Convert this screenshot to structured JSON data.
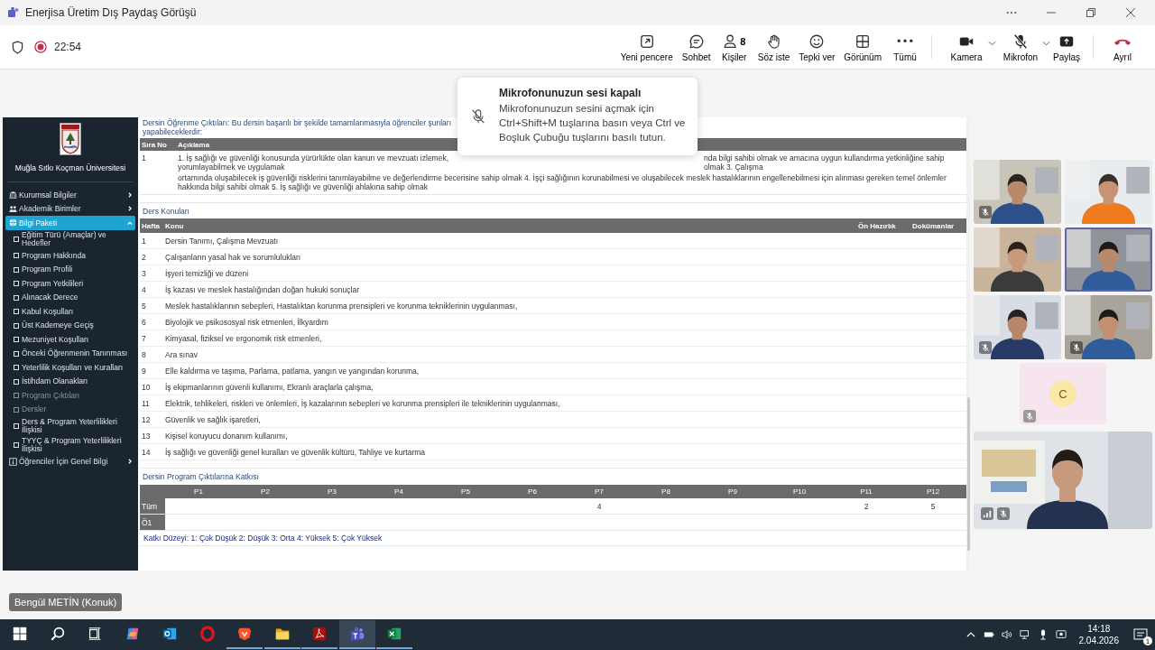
{
  "window": {
    "title": "Enerjisa Üretim Dış Paydaş Görüşü"
  },
  "meeting": {
    "recording": true,
    "elapsed": "22:54"
  },
  "controls": [
    {
      "kind": "popout",
      "label": "Yeni pencere"
    },
    {
      "kind": "chat",
      "label": "Sohbet"
    },
    {
      "kind": "people",
      "label": "Kişiler",
      "count": "8"
    },
    {
      "kind": "hand",
      "label": "Söz iste"
    },
    {
      "kind": "react",
      "label": "Tepki ver"
    },
    {
      "kind": "view",
      "label": "Görünüm"
    },
    {
      "kind": "more",
      "label": "Tümü"
    },
    {
      "kind": "camera",
      "label": "Kamera",
      "on": true
    },
    {
      "kind": "mic",
      "label": "Mikrofon",
      "on": false
    },
    {
      "kind": "share",
      "label": "Paylaş"
    },
    {
      "kind": "leave",
      "label": "Ayrıl"
    }
  ],
  "toast": {
    "title": "Mikrofonunuzun sesi kapalı",
    "message": "Mikrofonunuzun sesini açmak için Ctrl+Shift+M tuşlarına basın veya Ctrl ve Boşluk Çubuğu tuşlarını basılı tutun."
  },
  "shared_screen": {
    "sidebar": {
      "university": "Muğla Sıtkı Koçman Üniversitesi",
      "items": [
        {
          "kind": "building",
          "label": "Kurumsal Bilgiler",
          "expanded": false,
          "selected": false
        },
        {
          "kind": "people",
          "label": "Akademik Birimler",
          "expanded": false,
          "selected": false
        },
        {
          "kind": "globe",
          "label": "Bilgi Paketi",
          "expanded": true,
          "selected": true,
          "children": [
            {
              "label": "Eğitim Türü (Amaçlar) ve Hedefler",
              "disabled": false
            },
            {
              "label": "Program Hakkında",
              "disabled": false
            },
            {
              "label": "Program Profili",
              "disabled": false
            },
            {
              "label": "Program Yetkilileri",
              "disabled": false
            },
            {
              "label": "Alınacak Derece",
              "disabled": false
            },
            {
              "label": "Kabul Koşulları",
              "disabled": false
            },
            {
              "label": "Üst Kademeye Geçiş",
              "disabled": false
            },
            {
              "label": "Mezuniyet Koşulları",
              "disabled": false
            },
            {
              "label": "Önceki Öğrenmenin Tanınması",
              "disabled": false
            },
            {
              "label": "Yeterlilik Koşulları ve Kuralları",
              "disabled": false
            },
            {
              "label": "İstihdam Olanakları",
              "disabled": false
            },
            {
              "label": "Program Çıktıları",
              "disabled": true
            },
            {
              "label": "Dersler",
              "disabled": true
            },
            {
              "label": "Ders & Program Yeterlilikleri İlişkisi",
              "disabled": false
            },
            {
              "label": "TYYÇ & Program Yeterlilikleri İlişkisi",
              "disabled": false
            }
          ]
        },
        {
          "kind": "info",
          "label": "Öğrenciler İçin Genel Bilgi",
          "expanded": false,
          "selected": false
        }
      ]
    },
    "outcomes": {
      "heading": "Dersin Öğrenme Çıktıları: Bu dersin başarılı bir şekilde tamamlanmasıyla öğrenciler şunları yapabileceklerdir:",
      "columns": [
        "Sıra No",
        "Açıklama"
      ],
      "rows": [
        {
          "no": "1",
          "line_1_left": "1. İş sağlığı ve güvenliği konusunda yürürlükte olan kanun ve mevzuatı izlemek, yorumlayabilmek ve uygulamak",
          "line_1_right": "nda bilgi sahibi olmak ve amacına uygun kullandırma yetkinliğine sahip olmak 3. Çalışma",
          "line_2": "ortamında oluşabilecek iş güvenliği risklerini tanımlayabilme ve değerlendirme becerisine sahip olmak 4. İşçi sağlığının korunabilmesi ve oluşabilecek meslek hastalıklarının engellenebilmesi için alınması gereken temel önlemler hakkında bilgi sahibi olmak 5. İş sağlığı ve güvenliği ahlakına sahip olmak"
        }
      ]
    },
    "topics": {
      "heading": "Ders Konuları",
      "columns": [
        "Hafta",
        "Konu",
        "Ön Hazırlık",
        "Dokümanlar"
      ],
      "rows": [
        {
          "week": "1",
          "topic": "Dersin Tanımı, Çalışma Mevzuatı"
        },
        {
          "week": "2",
          "topic": "Çalışanların yasal hak ve sorumlulukları"
        },
        {
          "week": "3",
          "topic": "İşyeri temizliği ve düzeni"
        },
        {
          "week": "4",
          "topic": "İş kazası ve meslek hastalığından doğan hukuki sonuçlar"
        },
        {
          "week": "5",
          "topic": "Meslek hastalıklarının sebepleri, Hastalıktan korunma prensipleri ve korunma tekniklerinin uygulanması,"
        },
        {
          "week": "6",
          "topic": "Biyolojik ve psikososyal risk etmenleri, İlkyardım"
        },
        {
          "week": "7",
          "topic": "Kimyasal, fiziksel ve ergonomik risk etmenleri,"
        },
        {
          "week": "8",
          "topic": "Ara sınav"
        },
        {
          "week": "9",
          "topic": "Elle kaldırma ve taşıma, Parlama, patlama, yangın ve yangından korunma,"
        },
        {
          "week": "10",
          "topic": "İş ekipmanlarının güvenli kullanımı, Ekranlı araçlarla çalışma,"
        },
        {
          "week": "11",
          "topic": "Elektrik, tehlikeleri, riskleri ve önlemleri, İş kazalarının sebepleri ve korunma prensipleri ile tekniklerinin uygulanması,"
        },
        {
          "week": "12",
          "topic": "Güvenlik ve sağlık işaretleri,"
        },
        {
          "week": "13",
          "topic": "Kişisel koruyucu donanım kullanımı,"
        },
        {
          "week": "14",
          "topic": "İş sağlığı ve güvenliği genel kuralları ve güvenlik kültürü, Tahliye ve kurtarma"
        }
      ]
    },
    "contribution": {
      "heading": "Dersin Program Çıktılarına Katkısı",
      "row_labels": [
        "Tüm",
        "Ö1"
      ],
      "columns": [
        {
          "label": "P1"
        },
        {
          "label": "P2"
        },
        {
          "label": "P3"
        },
        {
          "label": "P4"
        },
        {
          "label": "P5"
        },
        {
          "label": "P6"
        },
        {
          "label": "P7",
          "row_1": "4"
        },
        {
          "label": "P8"
        },
        {
          "label": "P9"
        },
        {
          "label": "P10"
        },
        {
          "label": "P11",
          "row_1": "2"
        },
        {
          "label": "P12",
          "row_1": "5"
        }
      ],
      "legend": "Katkı Düzeyi: 1: Çok Düşük 2: Düşük 3: Orta 4: Yüksek 5: Çok Yüksek"
    }
  },
  "participants": [
    {
      "kind": "video",
      "muted": true,
      "speaking": false
    },
    {
      "kind": "video",
      "muted": false,
      "speaking": false
    },
    {
      "kind": "video",
      "muted": false,
      "speaking": false
    },
    {
      "kind": "video",
      "muted": false,
      "speaking": true
    },
    {
      "kind": "video",
      "muted": true,
      "speaking": false
    },
    {
      "kind": "video",
      "muted": true,
      "speaking": false
    },
    {
      "kind": "avatar",
      "initial": "C",
      "muted": true,
      "speaking": false
    },
    {
      "kind": "featured",
      "muted": true,
      "speaking": false
    }
  ],
  "name_tag": "Bengül METİN (Konuk)",
  "taskbar": {
    "apps": [
      {
        "kind": "search",
        "running": false,
        "selected": false
      },
      {
        "kind": "taskview",
        "running": false,
        "selected": false
      },
      {
        "kind": "copilot",
        "running": false,
        "selected": false
      },
      {
        "kind": "mail",
        "running": false,
        "selected": false
      },
      {
        "kind": "ring",
        "running": false,
        "selected": false
      },
      {
        "kind": "lion",
        "running": true,
        "selected": false
      },
      {
        "kind": "folder",
        "running": true,
        "selected": false
      },
      {
        "kind": "pdf",
        "running": true,
        "selected": false
      },
      {
        "kind": "teams",
        "running": true,
        "selected": true
      },
      {
        "kind": "sheet",
        "running": true,
        "selected": false
      }
    ],
    "time": "14:18",
    "date": "2.04.2026",
    "notifications": "1"
  }
}
